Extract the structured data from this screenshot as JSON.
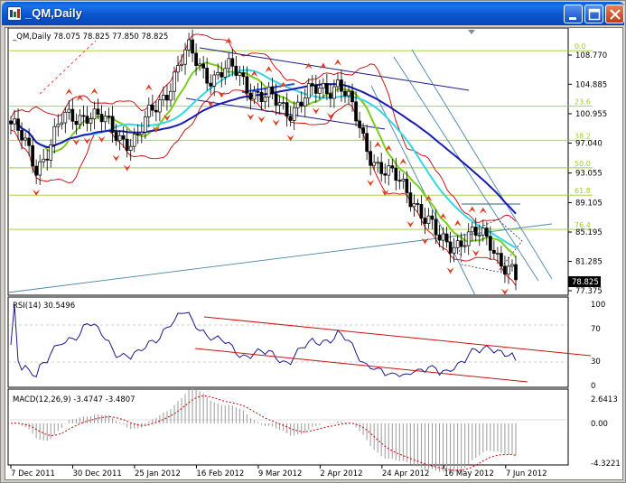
{
  "window": {
    "title": "_QM,Daily",
    "icon": "chart-window-icon",
    "buttons": [
      "minimize-icon",
      "maximize-icon",
      "close-icon"
    ]
  },
  "price_panel": {
    "header": "_QM,Daily  78.075 78.825 77.850 78.825",
    "y_ticks": [
      "108.770",
      "104.885",
      "100.955",
      "97.040",
      "93.055",
      "89.105",
      "85.195",
      "81.285",
      "77.375"
    ],
    "last_price": "78.825",
    "fib_levels": [
      "0.0",
      "23.6",
      "38.2",
      "50.0",
      "61.8",
      "76.4"
    ]
  },
  "rsi_panel": {
    "header": "RSI(14) 30.5496",
    "y_ticks": [
      "100",
      "70",
      "30",
      "0"
    ]
  },
  "macd_panel": {
    "header": "MACD(12,26,9) -3.4747 -3.4807",
    "y_ticks": [
      "2.6413",
      "0.00",
      "-4.3221"
    ]
  },
  "x_axis": {
    "labels": [
      "7 Dec 2011",
      "30 Dec 2011",
      "25 Jan 2012",
      "16 Feb 2012",
      "9 Mar 2012",
      "2 Apr 2012",
      "24 Apr 2012",
      "16 May 2012",
      "7 Jun 2012"
    ]
  },
  "colors": {
    "title_bar": "#0a55d0",
    "fib_line": "#9acd32",
    "trend_line_blue": "#1a1a8c",
    "ma_green": "#7ccd1a",
    "ma_cyan": "#33d6e6",
    "ma_navy": "#1a1ab4",
    "bands_red": "#cc0000",
    "fractal_arrow": "#e03c1e",
    "rsi_line": "#1a1a8c",
    "macd_hist": "#9a9a9a",
    "macd_signal": "#cc0000"
  },
  "chart_data": {
    "type": "candlestick",
    "symbol": "_QM",
    "timeframe": "Daily",
    "ohlc_last": {
      "open": 78.075,
      "high": 78.825,
      "low": 77.85,
      "close": 78.825
    },
    "ylim": [
      77.375,
      108.77
    ],
    "close_trace": [
      {
        "date": "7 Dec 2011",
        "close": 99.6
      },
      {
        "date": "15 Dec 2011",
        "close": 94.0
      },
      {
        "date": "30 Dec 2011",
        "close": 99.5
      },
      {
        "date": "10 Jan 2012",
        "close": 101.5
      },
      {
        "date": "25 Jan 2012",
        "close": 98.6
      },
      {
        "date": "2 Feb 2012",
        "close": 97.4
      },
      {
        "date": "16 Feb 2012",
        "close": 103.5
      },
      {
        "date": "24 Feb 2012",
        "close": 109.0
      },
      {
        "date": "9 Mar 2012",
        "close": 106.0
      },
      {
        "date": "20 Mar 2012",
        "close": 106.5
      },
      {
        "date": "2 Apr 2012",
        "close": 102.8
      },
      {
        "date": "10 Apr 2012",
        "close": 101.8
      },
      {
        "date": "24 Apr 2012",
        "close": 103.5
      },
      {
        "date": "1 May 2012",
        "close": 105.6
      },
      {
        "date": "8 May 2012",
        "close": 97.0
      },
      {
        "date": "16 May 2012",
        "close": 92.5
      },
      {
        "date": "24 May 2012",
        "close": 89.8
      },
      {
        "date": "1 Jun 2012",
        "close": 83.4
      },
      {
        "date": "7 Jun 2012",
        "close": 84.6
      },
      {
        "date": "15 Jun 2012",
        "close": 84.0
      },
      {
        "date": "20 Jun 2012",
        "close": 78.825
      }
    ],
    "rsi": {
      "period": 14,
      "last": 30.5496,
      "levels": [
        30,
        70
      ],
      "ylim": [
        0,
        100
      ]
    },
    "macd": {
      "fast": 12,
      "slow": 26,
      "signal": 9,
      "main": -3.4747,
      "signal_value": -3.4807,
      "ylim": [
        -4.3221,
        2.6413
      ]
    },
    "fibonacci": [
      {
        "label": "0.0",
        "price": 109.35
      },
      {
        "label": "23.6",
        "price": 101.95
      },
      {
        "label": "38.2",
        "price": 97.42
      },
      {
        "label": "50.0",
        "price": 93.75
      },
      {
        "label": "61.8",
        "price": 90.1
      },
      {
        "label": "76.4",
        "price": 85.55
      }
    ]
  }
}
